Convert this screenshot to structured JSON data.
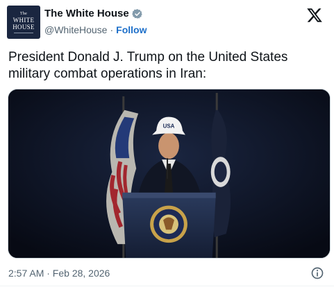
{
  "account": {
    "avatar_line1": "The",
    "avatar_line2": "WHITE",
    "avatar_line3": "HOUSE",
    "display_name": "The White House",
    "handle": "@WhiteHouse",
    "separator": "·",
    "follow_label": "Follow",
    "verified_icon": "verified-badge-icon",
    "verified_color": "#829aab"
  },
  "header": {
    "logo_icon": "x-logo-icon"
  },
  "tweet": {
    "text": "President Donald J. Trump on the United States military combat operations in Iran:",
    "media": {
      "type": "photo",
      "cap_text": "USA",
      "description_icon": "podium-seal-icon"
    },
    "timestamp": "2:57 AM · Feb 28, 2026"
  },
  "footer": {
    "info_icon": "info-icon"
  },
  "colors": {
    "text": "#0f1419",
    "secondary": "#536471",
    "link": "#1d6fc9",
    "media_bg": "#0b0f1c"
  }
}
